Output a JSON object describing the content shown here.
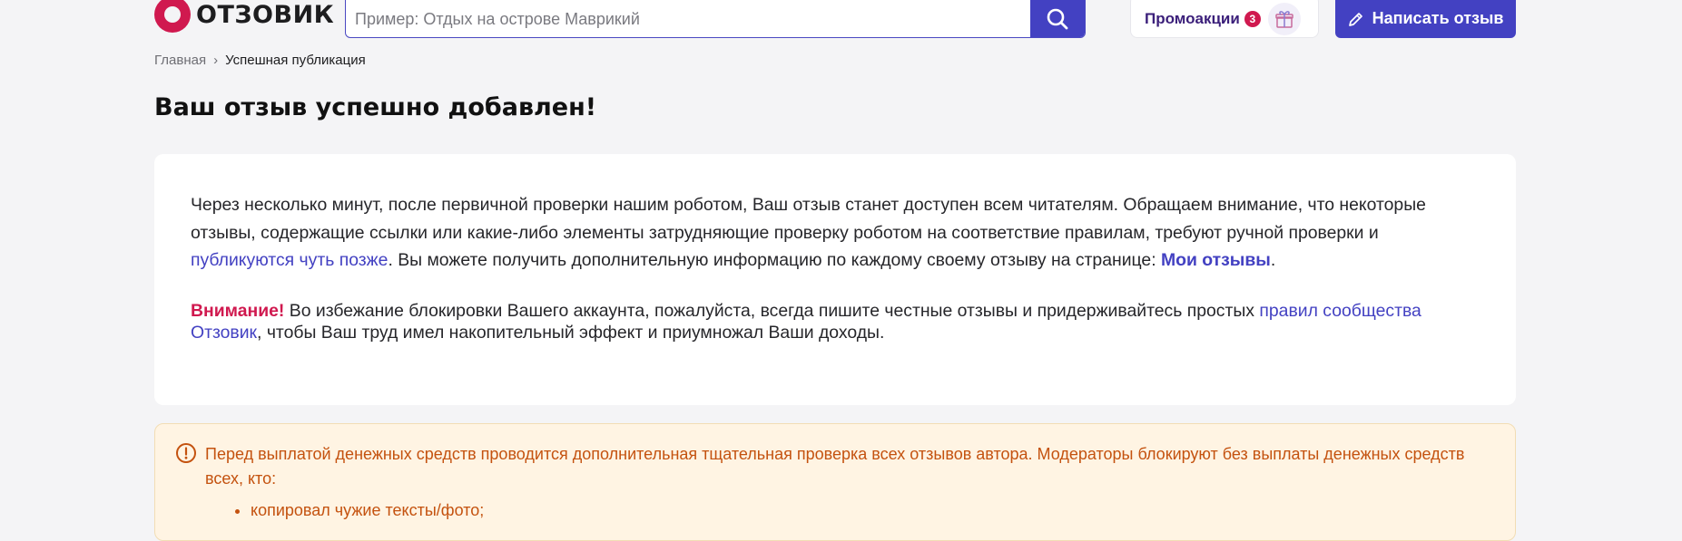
{
  "header": {
    "logo_text": "ОТЗОВИК",
    "search_placeholder": "Пример: Отдых на острове Маврикий",
    "promo_label": "Промоакции",
    "promo_count": "3",
    "write_button": "Написать отзыв"
  },
  "breadcrumb": {
    "home": "Главная",
    "separator": "›",
    "current": "Успешная публикация"
  },
  "page_title": "Ваш отзыв успешно добавлен!",
  "info": {
    "p1_part1": "Через несколько минут, после первичной проверки нашим роботом, Ваш отзыв станет доступен всем читателям. Обращаем внимание, что некоторые отзывы, содержащие ссылки или какие-либо элементы затрудняющие проверку роботом на соответствие правилам, требуют ручной проверки и ",
    "p1_link": "публикуются чуть позже",
    "p1_part2": ". Вы можете получить дополнительную информацию по каждому своему отзыву на странице: ",
    "p1_my_reviews": "Мои отзывы",
    "p1_end": ".",
    "p2_attention": "Внимание!",
    "p2_part1": " Во избежание блокировки Вашего аккаунта, пожалуйста, всегда пишите честные отзывы и придерживайтесь простых ",
    "p2_link": "правил сообщества Отзовик",
    "p2_part2": ", чтобы Ваш труд имел накопительный эффект и приумножал Ваши доходы."
  },
  "warning": {
    "text": "Перед выплатой денежных средств проводится дополнительная тщательная проверка всех отзывов автора. Модераторы блокируют без выплаты денежных средств всех, кто:",
    "items": [
      "копировал чужие тексты/фото;"
    ]
  },
  "colors": {
    "accent": "#4341c2",
    "brand": "#d0194f",
    "warning_text": "#c4520f",
    "warning_bg": "#fff4e3"
  }
}
